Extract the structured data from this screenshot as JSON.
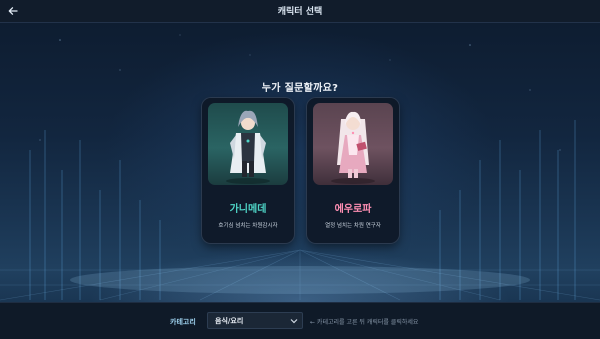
{
  "header": {
    "title": "캐릭터 선택",
    "back_icon": "arrow-left-icon"
  },
  "main": {
    "question": "누가 질문할까요?",
    "characters": [
      {
        "name": "가니메데",
        "description": "호기심 넘치는 차원감시자",
        "accent": "#4fd6c8"
      },
      {
        "name": "에우로파",
        "description": "열정 넘치는 차원 연구자",
        "accent": "#ff8fb3"
      }
    ]
  },
  "footer": {
    "category_label": "카테고리",
    "category_value": "음식/요리",
    "hint": "← 카테고리를 고른 뒤 캐릭터를 클릭하세요"
  }
}
